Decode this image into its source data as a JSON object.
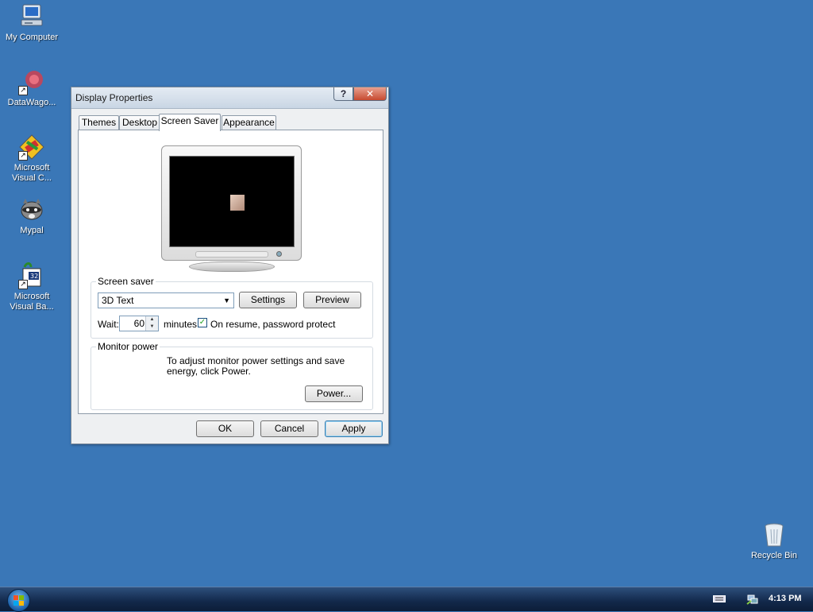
{
  "desktop": {
    "icons": [
      {
        "label": "My Computer",
        "icon": "computer-icon"
      },
      {
        "label": "DataWago...",
        "icon": "datawagon-icon"
      },
      {
        "label": "Microsoft\nVisual C...",
        "icon": "visual-c-icon"
      },
      {
        "label": "Mypal",
        "icon": "mypal-raccoon-icon"
      },
      {
        "label": "Microsoft\nVisual Ba...",
        "icon": "visual-basic-icon"
      },
      {
        "label": "Recycle Bin",
        "icon": "recycle-bin-icon"
      }
    ]
  },
  "window": {
    "title": "Display Properties",
    "help_glyph": "?",
    "close_glyph": "✕",
    "tabs": [
      {
        "label": "Themes",
        "active": false
      },
      {
        "label": "Desktop",
        "active": false
      },
      {
        "label": "Screen Saver",
        "active": true
      },
      {
        "label": "Appearance",
        "active": false
      }
    ],
    "screen_saver": {
      "group_label": "Screen saver",
      "selected": "3D Text",
      "settings_label": "Settings",
      "preview_label": "Preview",
      "wait_label": "Wait:",
      "wait_value": "60",
      "minutes_label": "minutes",
      "password_protect_checked": true,
      "password_protect_label": "On resume, password protect"
    },
    "monitor_power": {
      "group_label": "Monitor power",
      "text": "To adjust monitor power settings and save energy, click Power.",
      "power_label": "Power..."
    },
    "buttons": {
      "ok": "OK",
      "cancel": "Cancel",
      "apply": "Apply"
    }
  },
  "taskbar": {
    "time": "4:13 PM",
    "tray_icons": [
      "keyboard-icon",
      "network-icon"
    ]
  },
  "colors": {
    "desktop_bg": "#3a77b7",
    "taskbar_bg": "#12284a"
  }
}
